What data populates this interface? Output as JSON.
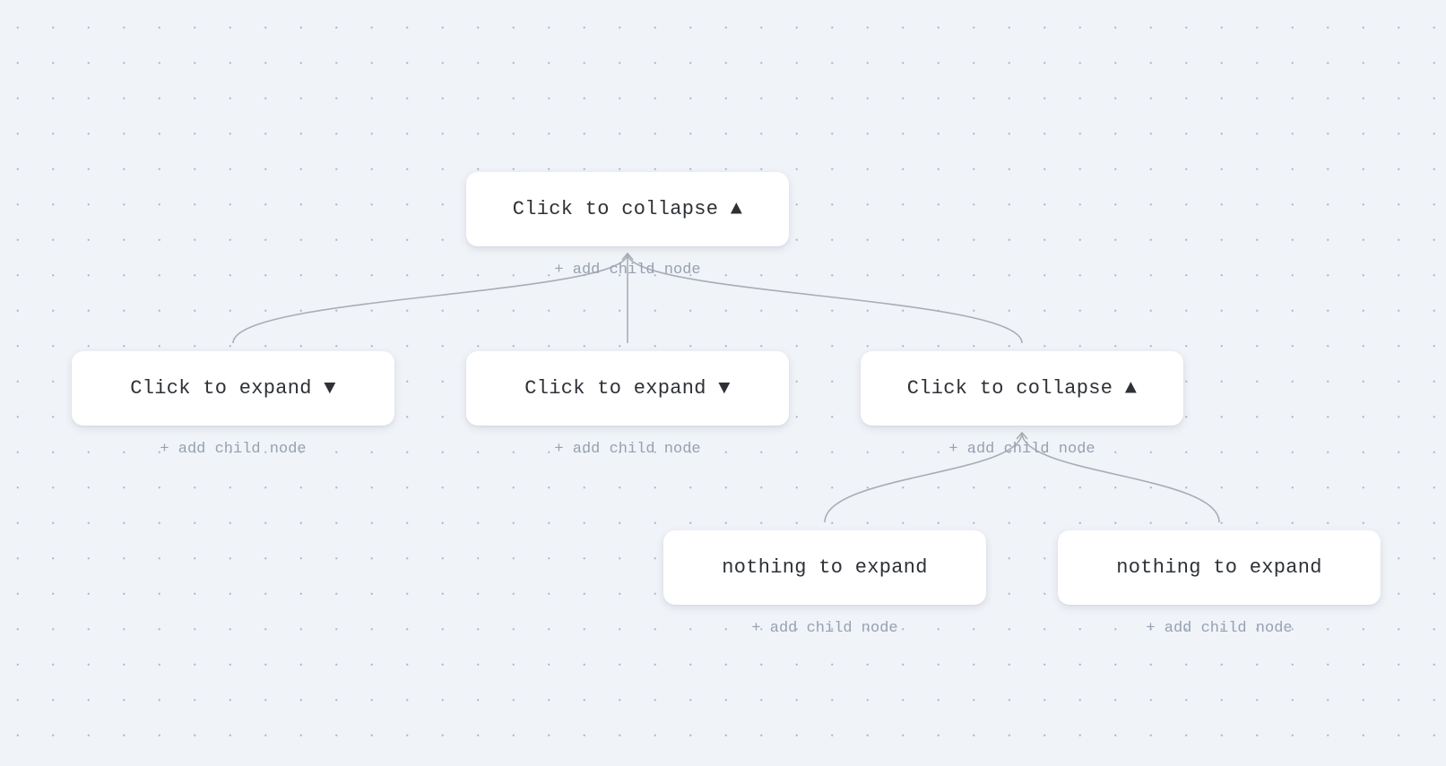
{
  "tree": {
    "root": {
      "label": "Click to collapse ▲",
      "add_label": "+ add child node"
    },
    "children": [
      {
        "label": "Click to expand ▼",
        "add_label": "+ add child node"
      },
      {
        "label": "Click to expand ▼",
        "add_label": "+ add child node"
      },
      {
        "label": "Click to collapse ▲",
        "add_label": "+ add child node"
      }
    ],
    "grandchildren": [
      {
        "label": "nothing to expand",
        "add_label": "+ add child node"
      },
      {
        "label": "nothing to expand",
        "add_label": "+ add child node"
      }
    ]
  },
  "colors": {
    "background": "#f0f3f8",
    "node_background": "#ffffff",
    "node_text": "#2e3136",
    "add_text": "#97a1b0",
    "edge": "#a9adb4"
  }
}
